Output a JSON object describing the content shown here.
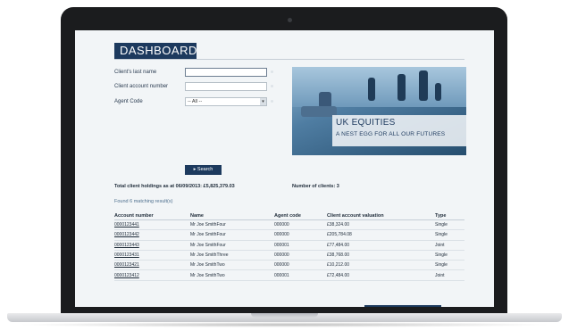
{
  "dashboard": {
    "title": "DASHBOARD"
  },
  "form": {
    "last_name_label": "Client's last name",
    "last_name_value": "",
    "account_number_label": "Client account number",
    "account_number_value": "",
    "agent_code_label": "Agent Code",
    "agent_code_value": "-- All --",
    "search_label": "Search"
  },
  "banner": {
    "heading": "UK EQUITIES",
    "subheading": "A NEST EGG FOR ALL OUR FUTURES"
  },
  "summary": {
    "holdings": "Total client holdings as at 06/09/2013: £5,825,379.03",
    "clients": "Number of clients: 3"
  },
  "results": {
    "found": "Found 6 matching result(s)"
  },
  "table": {
    "headers": [
      "Account number",
      "Name",
      "Agent code",
      "Client account valuation",
      "Type"
    ],
    "rows": [
      [
        "0000123441",
        "Mr Joe SmithFour",
        "000000",
        "£38,324.00",
        "Single"
      ],
      [
        "0000123442",
        "Mr Joe SmithFour",
        "000000",
        "£205,784.08",
        "Single"
      ],
      [
        "0000123443",
        "Mr Joe SmithFour",
        "000001",
        "£77,484.00",
        "Joint"
      ],
      [
        "0000123431",
        "Mr Joe SmithThree",
        "000000",
        "£38,768.00",
        "Single"
      ],
      [
        "0000123421",
        "Mr Joe SmithTwo",
        "000000",
        "£10,212.00",
        "Single"
      ],
      [
        "0000123412",
        "Mr Joe SmithTwo",
        "000001",
        "£72,484.00",
        "Joint"
      ]
    ]
  },
  "colors": {
    "accent": "#1d3a5e",
    "link": "#4e6f8e"
  }
}
